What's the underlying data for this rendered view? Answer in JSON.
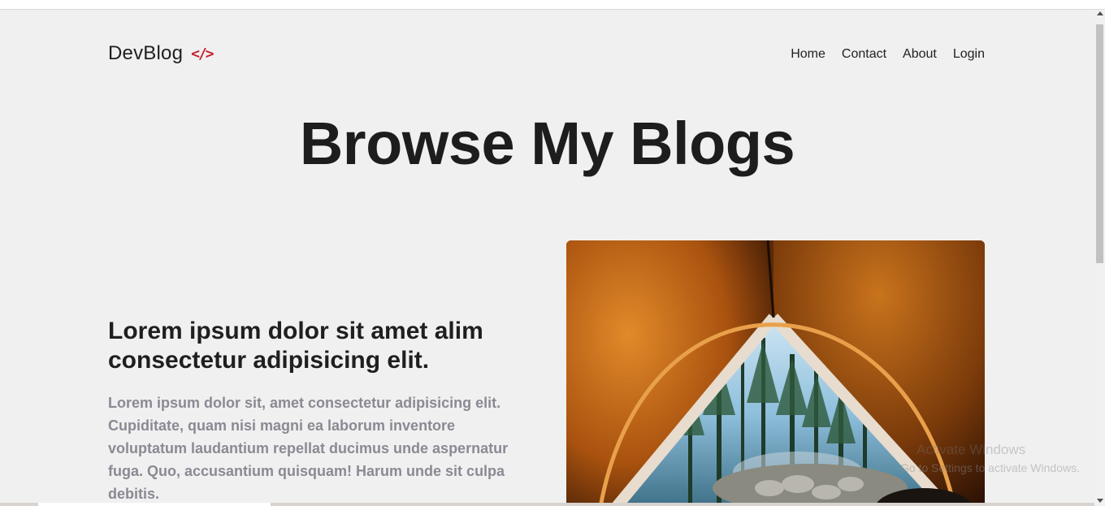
{
  "brand": {
    "name": "DevBlog",
    "icon": "code-icon",
    "icon_glyph": "</>",
    "icon_color": "#c41e2a"
  },
  "nav": {
    "items": [
      "Home",
      "Contact",
      "About",
      "Login"
    ]
  },
  "hero": {
    "title": "Browse My Blogs"
  },
  "post": {
    "title": "Lorem ipsum dolor sit amet alim consectetur adipisicing elit.",
    "excerpt": "Lorem ipsum dolor sit, amet consectetur adipisicing elit. Cupiditate, quam nisi magni ea laborum inventore voluptatum laudantium repellat ducimus unde aspernatur fuga. Quo, accusantium quisquam! Harum unde sit culpa debitis.",
    "image": "tent-forest-image"
  },
  "watermark": {
    "line1": "Activate Windows",
    "line2": "Go to Settings to activate Windows."
  },
  "colors": {
    "background": "#f0f0f0",
    "text": "#1c1c1c",
    "muted": "#8a8a94"
  }
}
